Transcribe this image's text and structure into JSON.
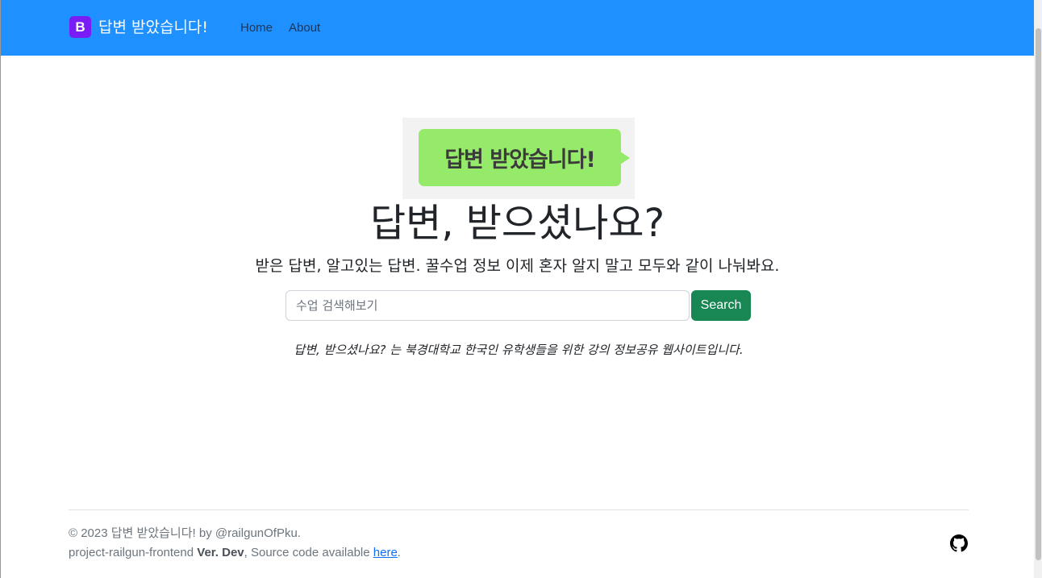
{
  "navbar": {
    "logo_letter": "B",
    "brand": "답변 받았습니다!",
    "links": [
      "Home",
      "About"
    ]
  },
  "hero": {
    "bubble_text": "답변 받았습니다!",
    "title": "답변, 받으셨나요?",
    "lead": "받은 답변, 알고있는 답변. 꿀수업 정보 이제 혼자 알지 말고 모두와 같이 나눠봐요."
  },
  "search": {
    "placeholder": "수업 검색해보기",
    "button": "Search"
  },
  "tagline": "답변, 받으셨나요? 는 북경대학교 한국인 유학생들을 위한 강의 정보공유 웹사이트입니다.",
  "footer": {
    "copyright": "© 2023 답변 받았습니다! by @railgunOfPku.",
    "project": "project-railgun-frontend",
    "ver_label": "Ver. Dev",
    "source_text": ", Source code available",
    "link_text": "here",
    "end": ".",
    "icon": "github-icon"
  },
  "colors": {
    "navbar": "#1e90ff",
    "logo": "#7a1cf5",
    "bubble": "#96ea6a",
    "search_button": "#198754",
    "link": "#0d6efd"
  }
}
